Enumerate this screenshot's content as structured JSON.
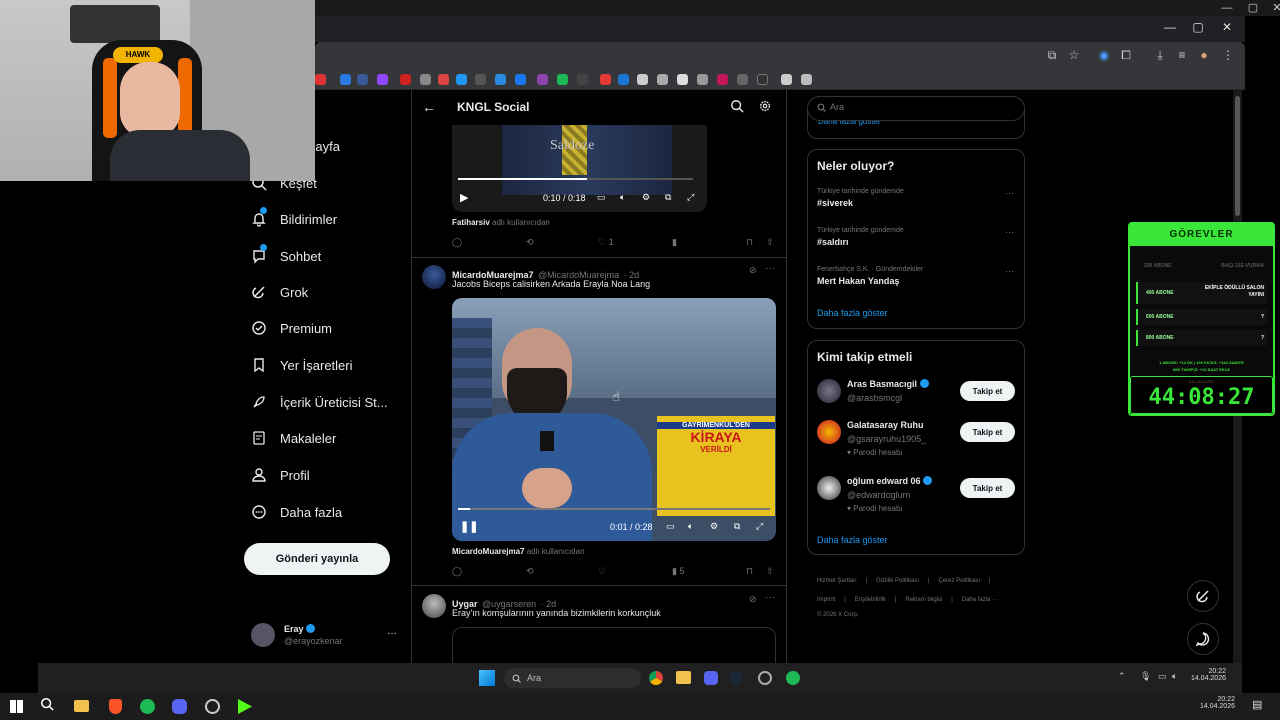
{
  "webcam": {
    "headset_label": "HAWK"
  },
  "chrome": {
    "window_controls": [
      "—",
      "▢",
      "✕"
    ]
  },
  "outer_window": {
    "controls": [
      "—",
      "▢",
      "✕"
    ]
  },
  "sidebar": {
    "items": [
      {
        "label": "Ana Sayfa",
        "icon": "home-icon"
      },
      {
        "label": "Keşfet",
        "icon": "search-icon"
      },
      {
        "label": "Bildirimler",
        "icon": "bell-icon"
      },
      {
        "label": "Sohbet",
        "icon": "chat-icon"
      },
      {
        "label": "Grok",
        "icon": "grok-icon"
      },
      {
        "label": "Premium",
        "icon": "premium-icon"
      },
      {
        "label": "Yer İşaretleri",
        "icon": "bookmark-icon"
      },
      {
        "label": "İçerik Üreticisi St...",
        "icon": "rocket-icon"
      },
      {
        "label": "Makaleler",
        "icon": "article-icon"
      },
      {
        "label": "Profil",
        "icon": "person-icon"
      },
      {
        "label": "Daha fazla",
        "icon": "more-circle-icon"
      }
    ],
    "post_button": "Gönderi yayınla",
    "account": {
      "name": "Eray",
      "handle": "@erayozkenar",
      "more": "···"
    }
  },
  "feed": {
    "title": "KNGL Social",
    "video1": {
      "time": "0:10 / 0:18",
      "caption_text": "Saldoze"
    },
    "tweet1_attribution": {
      "user": "Fatiharsiv",
      "suffix": "adlı kullanıcıdan"
    },
    "tweet1_actions": {
      "likes": "1"
    },
    "tweet2": {
      "name": "MicardoMuarejma7",
      "handle": "@MicardoMuarejma",
      "time": "· 2d",
      "text": "Jacobs Biceps calisirken Arkada Erayla Noa Lang",
      "video_time": "0:01 / 0:28",
      "sign_lines": [
        "GAYRİMENKUL'DEN",
        "KİRAYA",
        "VERİLDİ"
      ],
      "attribution_user": "MicardoMuarejma7",
      "attribution_suffix": "adlı kullanıcıdan",
      "views": "5"
    },
    "tweet3": {
      "name": "Uygar",
      "handle": "@uygarseren",
      "time": "· 2d",
      "text": "Eray'ın komşularının yanında bizimkilerin korkunçluk"
    }
  },
  "right": {
    "search_placeholder": "Ara",
    "partial_link": "Daha fazla göster",
    "trends": {
      "title": "Neler oluyor?",
      "items": [
        {
          "meta": "Türkiye tarihinde gündemde",
          "name": "#siverek"
        },
        {
          "meta": "Türkiye tarihinde gündemde",
          "name": "#saldırı"
        },
        {
          "meta": "Fenerbahçe S.K. · Gündemdekiler",
          "name": "Mert Hakan Yandaş"
        }
      ],
      "more": "Daha fazla göster"
    },
    "follow": {
      "title": "Kimi takip etmeli",
      "items": [
        {
          "name": "Aras Basmacıgil",
          "handle": "@arasbsmcgl",
          "note": "",
          "button": "Takip et"
        },
        {
          "name": "Galatasaray Ruhu",
          "handle": "@gsarayruhu1905_",
          "note": "Parodi hesabı",
          "button": "Takip et"
        },
        {
          "name": "oğlum edward 06",
          "handle": "@edwardoglum",
          "note": "Parodi hesabı",
          "button": "Takip et"
        }
      ],
      "more": "Daha fazla göster"
    },
    "footer": {
      "row1": [
        "Hizmet Şartları",
        "|",
        "Gizlilik Politikası",
        "|",
        "Çerez Politikası",
        "|"
      ],
      "row2": [
        "Imprint",
        "|",
        "Erişilebilirlik",
        "|",
        "Reklam bilgisi",
        "|",
        "Daha fazla ···"
      ],
      "copyright": "© 2026 X Corp."
    }
  },
  "gorevler": {
    "title": "GÖREVLER",
    "rows": [
      {
        "left": "200 ABONE",
        "right": "BAÇI-31E-VURMA",
        "dim": true
      },
      {
        "left": "400 ABONE",
        "right": "EKİPLE ÖDÜLLÜ SALON YAYINI",
        "dim": false
      },
      {
        "left": "600 ABONE",
        "right": "?",
        "dim": false
      },
      {
        "left": "800 ABONE",
        "right": "?",
        "dim": false
      }
    ],
    "info1": "1 ABONE: +12 DK  |  100 KICKS: +144 SANİYE",
    "info2": "60K TAKİPÇİ: +12 SAAT EKLE",
    "timer_label": "KALAN SÜRE",
    "timer": "44:08:27"
  },
  "taskbar_inner": {
    "search": "Ara",
    "time": "20:22",
    "date": "14.04.2026"
  },
  "taskbar": {
    "time": "20:22",
    "date": "14.04.2026"
  },
  "colors": {
    "accent": "#1d9bf0",
    "timer_green": "#39e639",
    "bg": "#000000"
  }
}
